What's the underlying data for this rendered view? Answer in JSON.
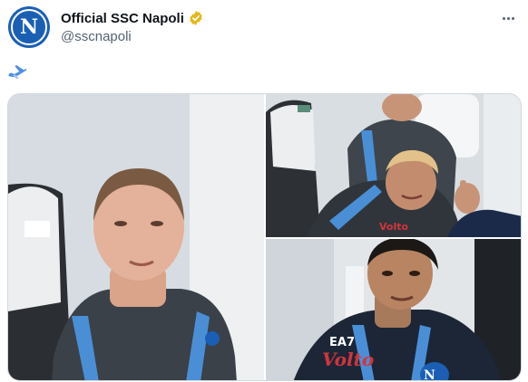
{
  "account": {
    "display_name": "Official SSC Napoli",
    "handle": "@sscnapoli",
    "avatar_letter": "N",
    "verified_icon": "gold-checkmark-icon"
  },
  "tweet": {
    "text_icon": "airplane-emoji-icon"
  },
  "media": {
    "photos": [
      {
        "icon": "photo-player-seated-plane"
      },
      {
        "icon": "photo-players-selfie-plane"
      },
      {
        "icon": "photo-player-closeup-plane"
      }
    ],
    "jersey_text": "Volto",
    "brand_text": "EA7"
  },
  "colors": {
    "napoli_blue": "#1a5fb4",
    "verified_gold": "#e2b719",
    "text_secondary": "#536471",
    "border": "#cfd9de"
  }
}
